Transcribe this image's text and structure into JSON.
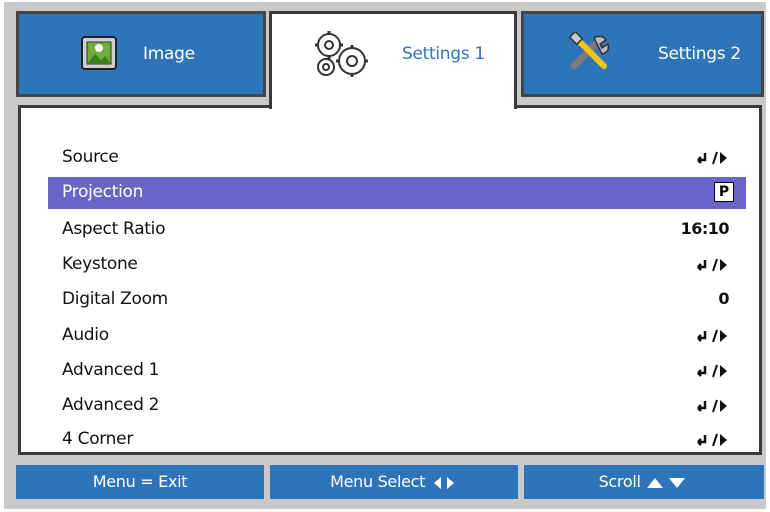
{
  "tabs": [
    {
      "label": "Image",
      "icon": "image-icon",
      "active": false
    },
    {
      "label": "Settings 1",
      "icon": "gears-icon",
      "active": true
    },
    {
      "label": "Settings 2",
      "icon": "tools-icon",
      "active": false
    }
  ],
  "menu": {
    "items": [
      {
        "label": "Source",
        "value": "",
        "value_icon": "enter-right-icon"
      },
      {
        "label": "Projection",
        "value": "P",
        "value_icon": "projection-icon",
        "selected": true
      },
      {
        "label": "Aspect Ratio",
        "value": "16:10"
      },
      {
        "label": "Keystone",
        "value": "",
        "value_icon": "enter-right-icon"
      },
      {
        "label": "Digital Zoom",
        "value": "0"
      },
      {
        "label": "Audio",
        "value": "",
        "value_icon": "enter-right-icon"
      },
      {
        "label": "Advanced 1",
        "value": "",
        "value_icon": "enter-right-icon"
      },
      {
        "label": "Advanced 2",
        "value": "",
        "value_icon": "enter-right-icon"
      },
      {
        "label": "4 Corner",
        "value": "",
        "value_icon": "enter-right-icon"
      }
    ]
  },
  "footer": {
    "exit_label": "Menu = Exit",
    "select_label": "Menu Select",
    "scroll_label": "Scroll"
  },
  "colors": {
    "tab_blue": "#2e74b8",
    "selection": "#6a64c8",
    "frame_gray": "#c9c9c9"
  }
}
